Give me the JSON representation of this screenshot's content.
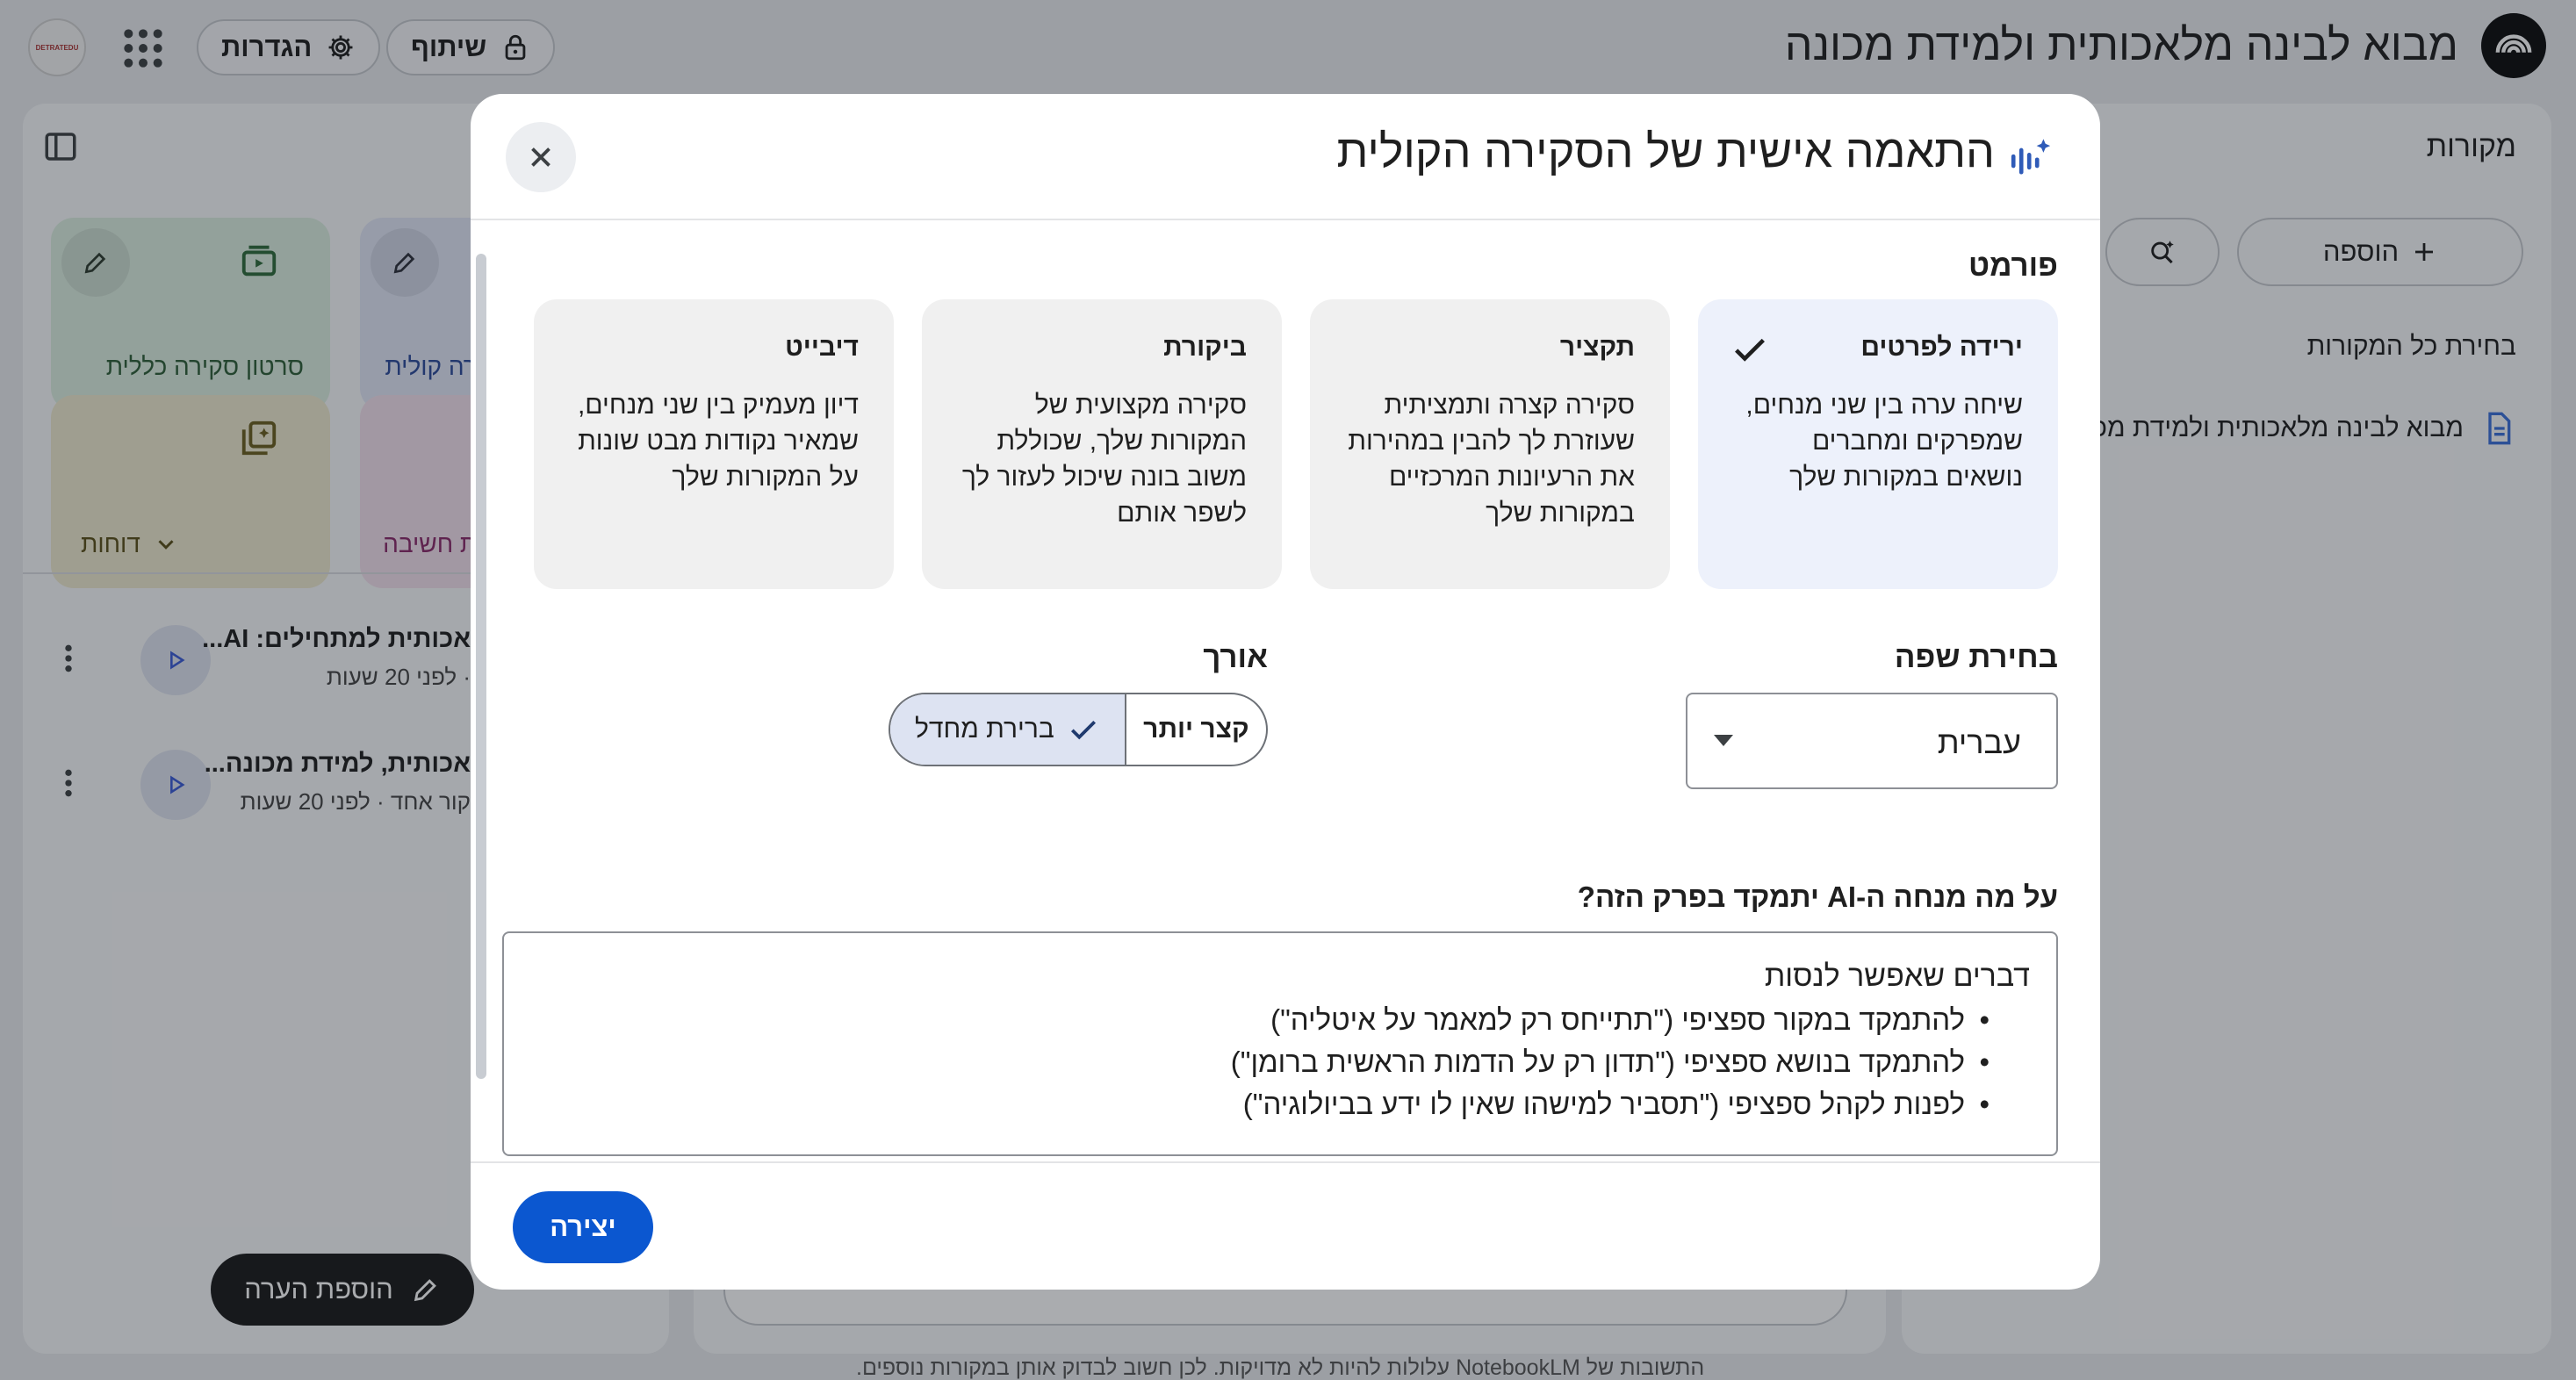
{
  "app": {
    "title": "מבוא לבינה מלאכותית ולמידת מכונה",
    "share_label": "שיתוף",
    "settings_label": "הגדרות",
    "avatar_text": "DETRATEDU"
  },
  "sources_panel": {
    "title": "מקורות",
    "add_label": "הוספה",
    "select_all_label": "בחירת כל המקורות",
    "source_name": "מבוא לבינה מלאכותית ולמידת מכ"
  },
  "studio": {
    "tiles": [
      {
        "label": "סרטון סקירה כללית"
      },
      {
        "label": "ירה קולית"
      },
      {
        "label": "דוחות"
      },
      {
        "label": "ית חשיבה"
      }
    ],
    "artifacts": [
      {
        "title": "אכותית למתחילים: AI...",
        "meta": "· לפני 20 שעות"
      },
      {
        "title": "אכותית, למידת מכונה...",
        "meta": "קור אחד · לפני 20 שעות"
      }
    ],
    "add_note_label": "הוספת הערה"
  },
  "footer_note": "התשובות של NotebookLM עלולות להיות לא מדויקות. לכן חשוב לבדוק אותן במקורות נוספים.",
  "modal": {
    "title": "התאמה אישית של הסקירה הקולית",
    "format_label": "פורמט",
    "formats": [
      {
        "title": "ירידה לפרטים",
        "desc": "שיחה ערה בין שני מנחים, שמפרקים ומחברים נושאים במקורות שלך",
        "selected": true
      },
      {
        "title": "תקציר",
        "desc": "סקירה קצרה ותמציתית שעוזרת לך להבין במהירות את הרעיונות המרכזיים במקורות שלך",
        "selected": false
      },
      {
        "title": "ביקורת",
        "desc": "סקירה מקצועית של המקורות שלך, שכוללת משוב בונה שיכול לעזור לך לשפר אותם",
        "selected": false
      },
      {
        "title": "דיבייט",
        "desc": "דיון מעמיק בין שני מנחים, שמאיר נקודות מבט שונות על המקורות שלך",
        "selected": false
      }
    ],
    "language_label": "בחירת שפה",
    "language_value": "עברית",
    "length_label": "אורך",
    "length_options": [
      {
        "label": "קצר יותר",
        "selected": false
      },
      {
        "label": "ברירת מחדל",
        "selected": true
      }
    ],
    "focus_label": "על מה מנחה ה-AI יתמקד בפרק הזה?",
    "focus_placeholder_heading": "דברים שאפשר לנסות",
    "focus_placeholder_items": [
      "להתמקד במקור ספציפי (\"תתייחס רק למאמר על איטליה\")",
      "להתמקד בנושא ספציפי (\"תדון רק על הדמות הראשית ברומן\")",
      "לפנות לקהל ספציפי (\"תסביר למישהו שאין לו ידע בביולוגיה\")"
    ],
    "create_label": "יצירה"
  },
  "colors": {
    "accent": "#0b57d0",
    "selected_card": "#edf1fb",
    "selected_segment": "#dde3f2",
    "tile_green": "#dceee0",
    "tile_blue": "#e1e6f6",
    "tile_yellow": "#eeeacf",
    "tile_pink": "#f3e0ec"
  },
  "icons": [
    "notebook-logo-icon",
    "lock-icon",
    "gear-icon",
    "apps-grid-icon",
    "plus-icon",
    "search-sparkle-icon",
    "document-icon",
    "panel-toggle-icon",
    "pencil-icon",
    "video-icon",
    "report-icon",
    "play-icon",
    "more-vert-icon",
    "audio-sparkle-icon",
    "close-icon",
    "check-icon",
    "caret-down-icon"
  ]
}
